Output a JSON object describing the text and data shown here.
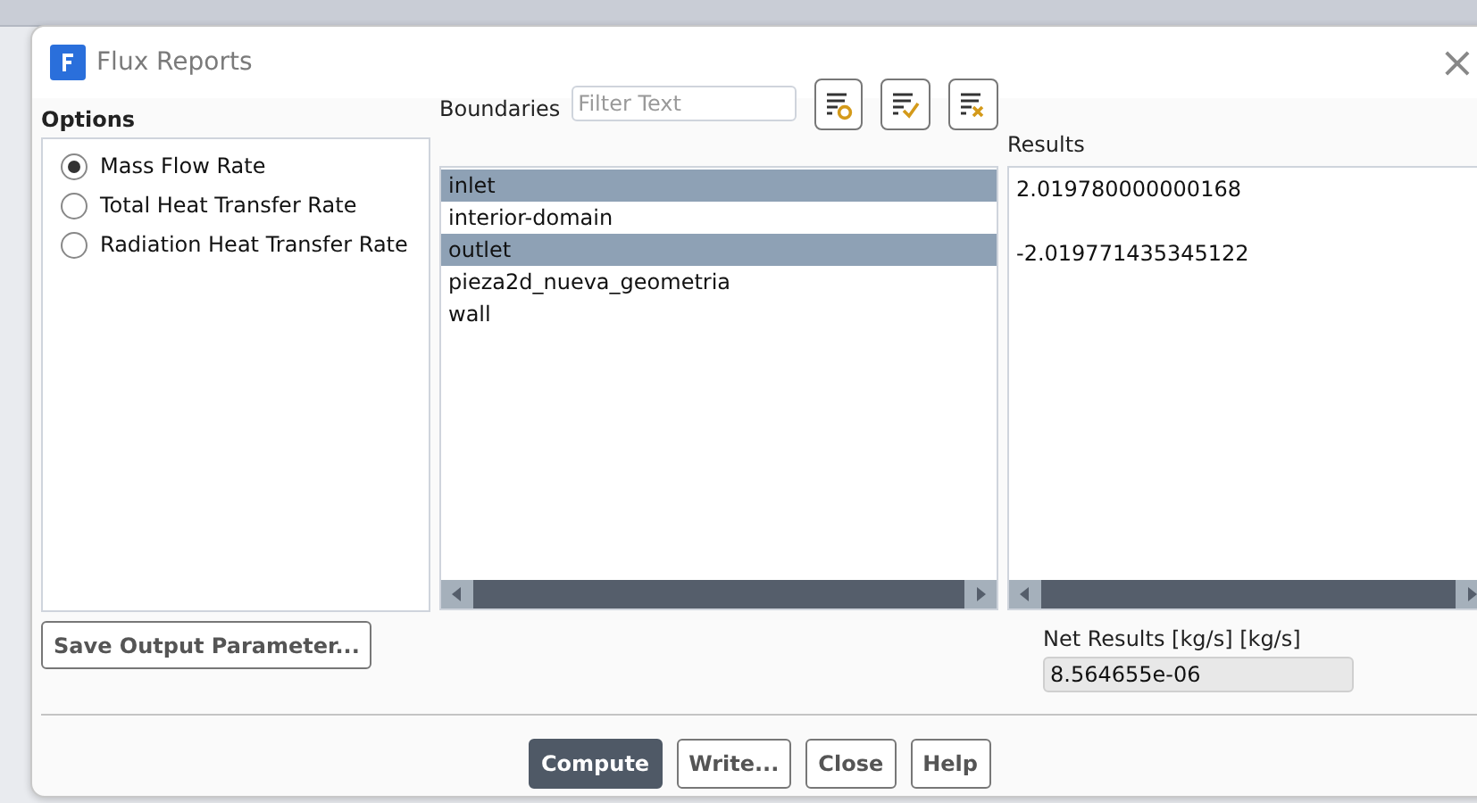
{
  "window": {
    "title": "Flux Reports",
    "close": "×"
  },
  "options": {
    "label": "Options",
    "items": [
      {
        "label": "Mass Flow Rate",
        "selected": true
      },
      {
        "label": "Total Heat Transfer Rate",
        "selected": false
      },
      {
        "label": "Radiation Heat Transfer Rate",
        "selected": false
      }
    ]
  },
  "boundaries": {
    "label": "Boundaries",
    "filter": {
      "placeholder": "Filter Text"
    },
    "items": [
      {
        "label": "inlet",
        "selected": true,
        "result": "2.019780000000168"
      },
      {
        "label": "interior-domain",
        "selected": false
      },
      {
        "label": "outlet",
        "selected": true,
        "result": "-2.019771435345122"
      },
      {
        "label": "pieza2d_nueva_geometria",
        "selected": false
      },
      {
        "label": "wall",
        "selected": false
      }
    ]
  },
  "results": {
    "label": "Results"
  },
  "save_button": "Save Output Parameter...",
  "net_results": {
    "label": "Net Results [kg/s] [kg/s]",
    "value": "8.564655e-06"
  },
  "buttons": [
    {
      "label": "Compute",
      "primary": true
    },
    {
      "label": "Write...",
      "primary": false
    },
    {
      "label": "Close",
      "primary": false
    },
    {
      "label": "Help",
      "primary": false
    }
  ]
}
